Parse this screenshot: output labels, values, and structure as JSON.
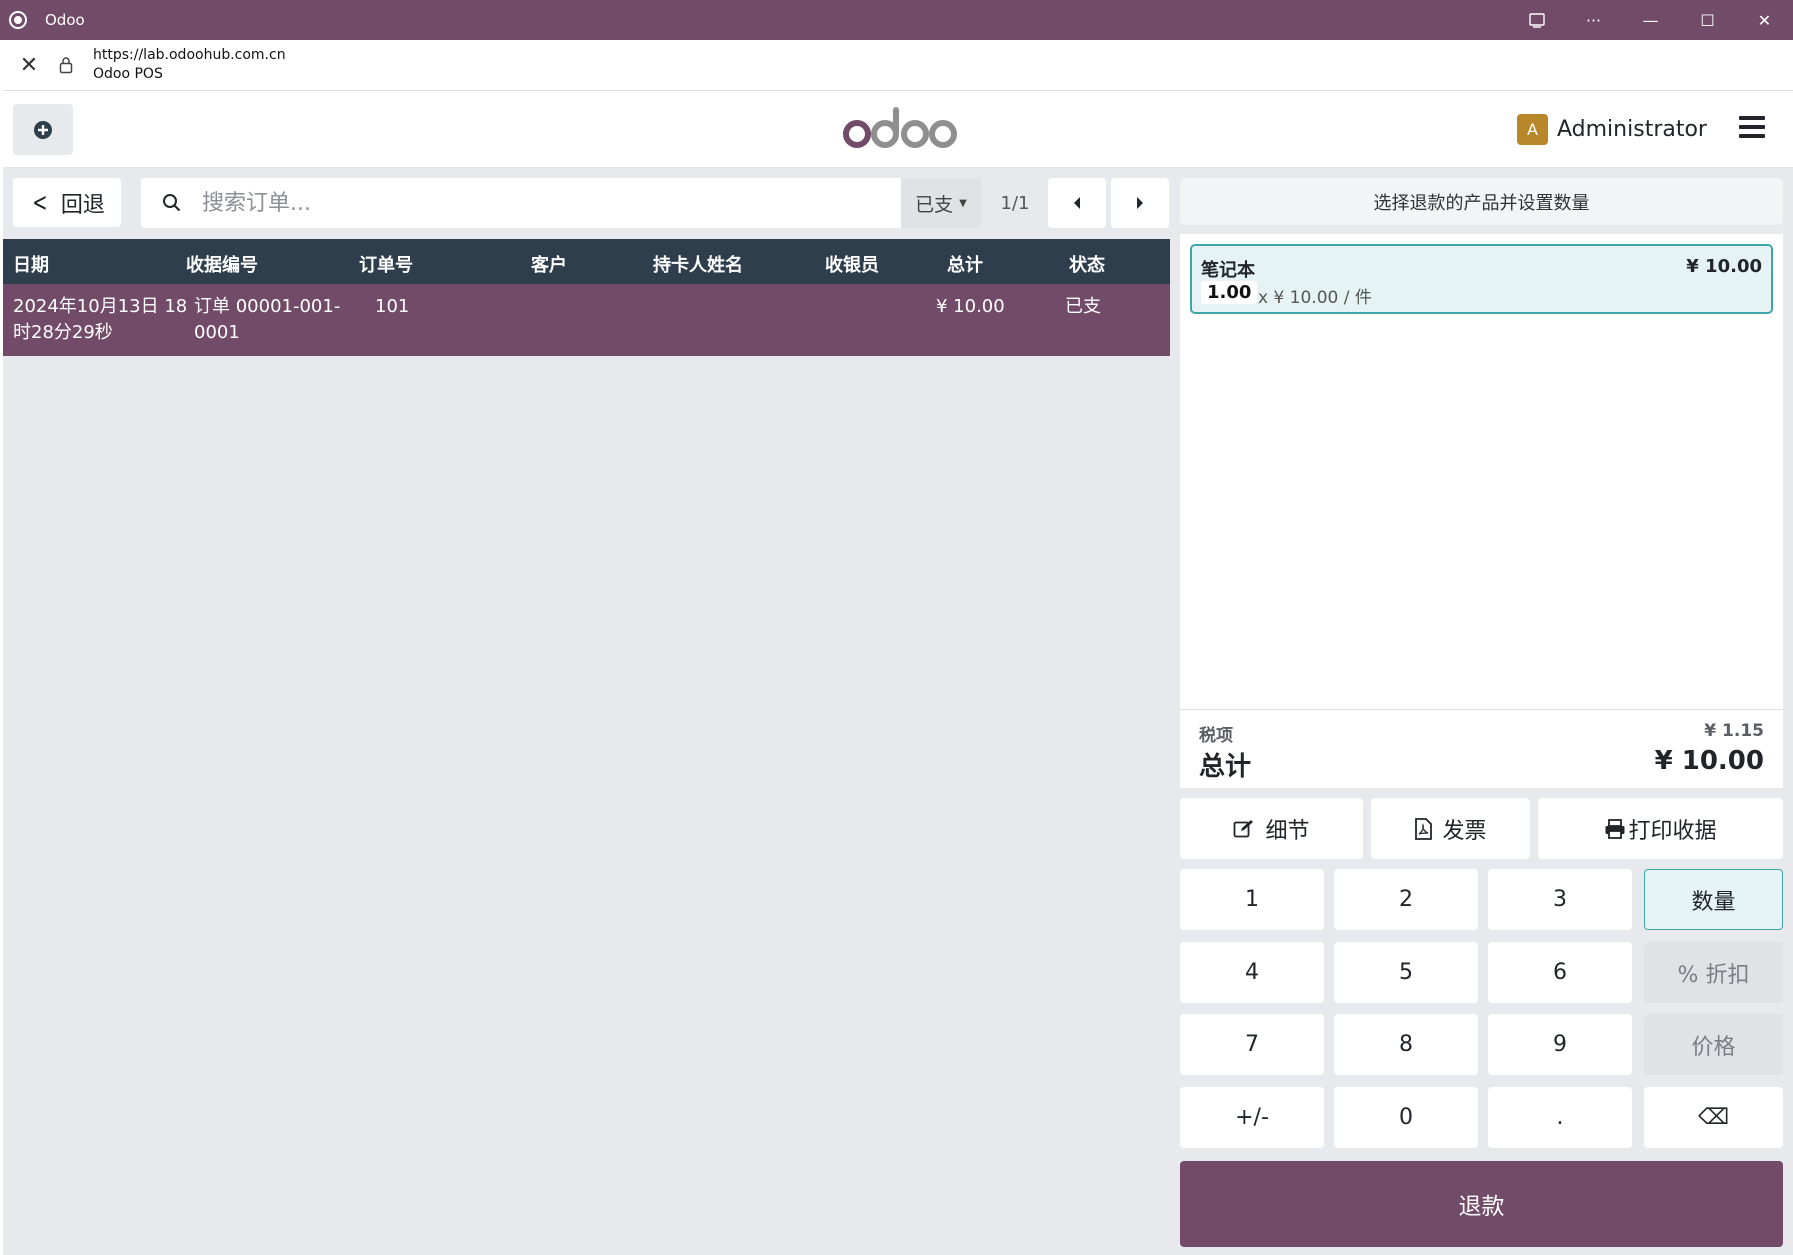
{
  "window": {
    "title": "Odoo",
    "controls": [
      "cast",
      "more",
      "minimize",
      "maximize",
      "close"
    ]
  },
  "address_bar": {
    "url": "https://lab.odoohub.com.cn",
    "page_title": "Odoo POS"
  },
  "header": {
    "logo_text": "odoo",
    "user": {
      "initial": "A",
      "name": "Administrator"
    }
  },
  "colors": {
    "brand": "#714b67",
    "table_header": "#2f3e4d",
    "selected_line_bg": "#e6f3f4",
    "selected_line_border": "#3fa6a8",
    "avatar": "#b8872a"
  },
  "toolbar": {
    "back_label": "回退",
    "search_placeholder": "搜索订单...",
    "filter_value": "已支",
    "pager": "1/1"
  },
  "orders_table": {
    "columns": [
      "日期",
      "收据编号",
      "订单号",
      "客户",
      "持卡人姓名",
      "收银员",
      "总计",
      "状态"
    ],
    "rows": [
      {
        "date_line1": "2024年10月13日 18",
        "date_line2": "时28分29秒",
        "receipt_line1": "订单 00001-001-",
        "receipt_line2": "0001",
        "order_no": "101",
        "customer": "",
        "cardholder": "",
        "cashier": "",
        "total": "¥ 10.00",
        "status": "已支"
      }
    ]
  },
  "refund_panel": {
    "hint": "选择退款的产品并设置数量",
    "lines": [
      {
        "product": "笔记本",
        "price": "¥ 10.00",
        "qty": "1.00",
        "unit_info": "x ¥ 10.00 / 件"
      }
    ],
    "tax_label": "税项",
    "tax_value": "¥ 1.15",
    "total_label": "总计",
    "total_value": "¥ 10.00"
  },
  "controls": {
    "details": "细节",
    "invoice": "发票",
    "print_receipt": "打印收据"
  },
  "numpad": {
    "keys": [
      "1",
      "2",
      "3",
      "4",
      "5",
      "6",
      "7",
      "8",
      "9",
      "+/-",
      "0",
      "."
    ],
    "mode_qty": "数量",
    "mode_disc": "% 折扣",
    "mode_price": "价格",
    "backspace": "⌫"
  },
  "refund_button": "退款"
}
